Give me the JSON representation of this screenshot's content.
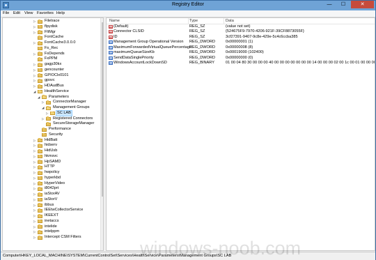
{
  "window": {
    "title": "Registry Editor",
    "min_glyph": "—",
    "max_glyph": "☐",
    "close_glyph": "✕"
  },
  "menu": [
    "File",
    "Edit",
    "View",
    "Favorites",
    "Help"
  ],
  "tree": [
    {
      "label": "Filetrace",
      "depth": 0,
      "expander": "▷",
      "open": false,
      "selected": false
    },
    {
      "label": "flpydisk",
      "depth": 0,
      "expander": "▷",
      "open": false,
      "selected": false
    },
    {
      "label": "FltMgr",
      "depth": 0,
      "expander": "▷",
      "open": false,
      "selected": false
    },
    {
      "label": "FontCache",
      "depth": 0,
      "expander": "",
      "open": false,
      "selected": false
    },
    {
      "label": "FontCache3.0.0.0",
      "depth": 0,
      "expander": "▷",
      "open": false,
      "selected": false
    },
    {
      "label": "Fs_Rec",
      "depth": 0,
      "expander": "",
      "open": false,
      "selected": false
    },
    {
      "label": "FsDepends",
      "depth": 0,
      "expander": "▷",
      "open": false,
      "selected": false
    },
    {
      "label": "FxPPM",
      "depth": 0,
      "expander": "",
      "open": false,
      "selected": false
    },
    {
      "label": "gagp30kx",
      "depth": 0,
      "expander": "▷",
      "open": false,
      "selected": false
    },
    {
      "label": "gencounter",
      "depth": 0,
      "expander": "▷",
      "open": false,
      "selected": false
    },
    {
      "label": "GPIOClx0101",
      "depth": 0,
      "expander": "▷",
      "open": false,
      "selected": false
    },
    {
      "label": "gpsvc",
      "depth": 0,
      "expander": "▷",
      "open": false,
      "selected": false
    },
    {
      "label": "HDAudBus",
      "depth": 0,
      "expander": "▷",
      "open": false,
      "selected": false
    },
    {
      "label": "HealthService",
      "depth": 0,
      "expander": "◢",
      "open": true,
      "selected": false
    },
    {
      "label": "Parameters",
      "depth": 1,
      "expander": "◢",
      "open": true,
      "selected": false
    },
    {
      "label": "ConnectorManager",
      "depth": 2,
      "expander": "▷",
      "open": false,
      "selected": false
    },
    {
      "label": "Management Groups",
      "depth": 2,
      "expander": "◢",
      "open": true,
      "selected": false
    },
    {
      "label": "SC LAB",
      "depth": 3,
      "expander": "▷",
      "open": true,
      "selected": true
    },
    {
      "label": "Registered Connectors",
      "depth": 2,
      "expander": "▷",
      "open": false,
      "selected": false
    },
    {
      "label": "SecureStorageManager",
      "depth": 2,
      "expander": "",
      "open": false,
      "selected": false
    },
    {
      "label": "Performance",
      "depth": 1,
      "expander": "",
      "open": false,
      "selected": false
    },
    {
      "label": "Security",
      "depth": 1,
      "expander": "",
      "open": false,
      "selected": false
    },
    {
      "label": "HidBatt",
      "depth": 0,
      "expander": "▷",
      "open": false,
      "selected": false
    },
    {
      "label": "hidserv",
      "depth": 0,
      "expander": "▷",
      "open": false,
      "selected": false
    },
    {
      "label": "HidUsb",
      "depth": 0,
      "expander": "▷",
      "open": false,
      "selected": false
    },
    {
      "label": "hkmsvc",
      "depth": 0,
      "expander": "▷",
      "open": false,
      "selected": false
    },
    {
      "label": "HpSAMD",
      "depth": 0,
      "expander": "▷",
      "open": false,
      "selected": false
    },
    {
      "label": "HTTP",
      "depth": 0,
      "expander": "▷",
      "open": false,
      "selected": false
    },
    {
      "label": "hwpolicy",
      "depth": 0,
      "expander": "▷",
      "open": false,
      "selected": false
    },
    {
      "label": "hyperkbd",
      "depth": 0,
      "expander": "▷",
      "open": false,
      "selected": false
    },
    {
      "label": "HyperVideo",
      "depth": 0,
      "expander": "▷",
      "open": false,
      "selected": false
    },
    {
      "label": "i8042prt",
      "depth": 0,
      "expander": "▷",
      "open": false,
      "selected": false
    },
    {
      "label": "iaStorAV",
      "depth": 0,
      "expander": "▷",
      "open": false,
      "selected": false
    },
    {
      "label": "iaStorV",
      "depth": 0,
      "expander": "▷",
      "open": false,
      "selected": false
    },
    {
      "label": "ibbus",
      "depth": 0,
      "expander": "▷",
      "open": false,
      "selected": false
    },
    {
      "label": "IEEtwCollectorService",
      "depth": 0,
      "expander": "▷",
      "open": false,
      "selected": false
    },
    {
      "label": "IKEEXT",
      "depth": 0,
      "expander": "▷",
      "open": false,
      "selected": false
    },
    {
      "label": "inetaccs",
      "depth": 0,
      "expander": "▷",
      "open": false,
      "selected": false
    },
    {
      "label": "intelide",
      "depth": 0,
      "expander": "▷",
      "open": false,
      "selected": false
    },
    {
      "label": "intelppm",
      "depth": 0,
      "expander": "▷",
      "open": false,
      "selected": false
    },
    {
      "label": "Intercept CSM Filters",
      "depth": 0,
      "expander": "▷",
      "open": false,
      "selected": false
    }
  ],
  "list": {
    "columns": {
      "name": "Name",
      "type": "Type",
      "data": "Data"
    },
    "rows": [
      {
        "icon": "ab",
        "kind": "sz",
        "name": "(Default)",
        "type": "REG_SZ",
        "data": "(value not set)"
      },
      {
        "icon": "ab",
        "kind": "sz",
        "name": "Connector CLSID",
        "type": "REG_SZ",
        "data": "{524675F9-7970-4206-921F-39CF8873055F}"
      },
      {
        "icon": "ab",
        "kind": "sz",
        "name": "ID",
        "type": "REG_SZ",
        "data": "3cf27391-9407-9c8e-429e-5c4c6ccba385"
      },
      {
        "icon": "01",
        "kind": "bin",
        "name": "Management Group Operational Version",
        "type": "REG_DWORD",
        "data": "0x00000001 (1)"
      },
      {
        "icon": "01",
        "kind": "bin",
        "name": "MaximumForwardedVirtualQueuePercentage",
        "type": "REG_DWORD",
        "data": "0x00000008 (8)"
      },
      {
        "icon": "01",
        "kind": "bin",
        "name": "maximumQueueSizeKb",
        "type": "REG_DWORD",
        "data": "0x00019000 (102400)"
      },
      {
        "icon": "01",
        "kind": "bin",
        "name": "SendDataSinglePriority",
        "type": "REG_DWORD",
        "data": "0x00000000 (0)"
      },
      {
        "icon": "01",
        "kind": "bin",
        "name": "WindowsAccountLockDownSD",
        "type": "REG_BINARY",
        "data": "01 00 04 80 30 00 00 00 40 00 00 00 00 00 00 00 14 00 00 00 02 00 1c 00 01 00 00 00 00 0..."
      }
    ]
  },
  "statusbar": {
    "path": "Computer\\HKEY_LOCAL_MACHINE\\SYSTEM\\CurrentControlSet\\Services\\HealthService\\Parameters\\Management Groups\\SC LAB"
  },
  "watermark": "windows-noob.com"
}
